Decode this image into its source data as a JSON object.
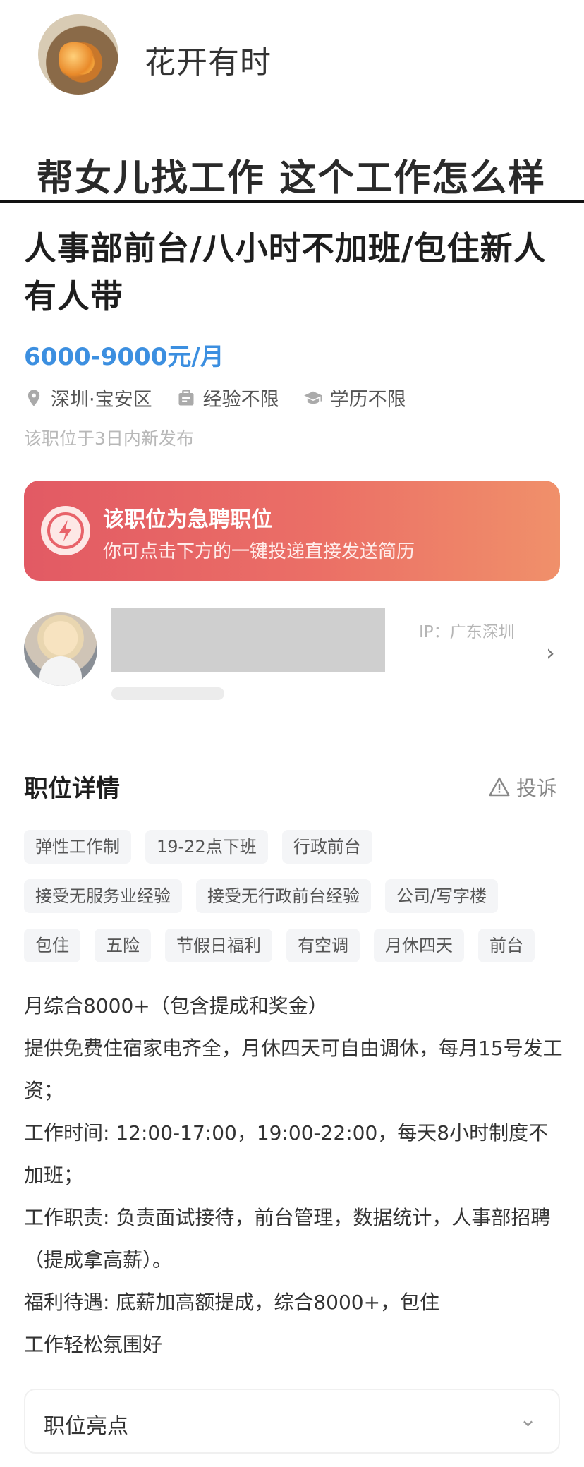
{
  "poster": {
    "name": "花开有时",
    "caption": "帮女儿找工作 这个工作怎么样"
  },
  "job": {
    "title": "人事部前台/八小时不加班/包住新人有人带",
    "salary": "6000-9000元/月",
    "location": "深圳·宝安区",
    "experience": "经验不限",
    "education": "学历不限",
    "posted": "该职位于3日内新发布"
  },
  "urgent": {
    "title": "该职位为急聘职位",
    "subtitle": "你可点击下方的一键投递直接发送简历"
  },
  "recruiter": {
    "ip": "IP：广东深圳"
  },
  "details": {
    "section_title": "职位详情",
    "report_label": "投诉",
    "tags": [
      [
        "弹性工作制",
        "19-22点下班",
        "行政前台"
      ],
      [
        "接受无服务业经验",
        "接受无行政前台经验",
        "公司/写字楼"
      ],
      [
        "包住",
        "五险",
        "节假日福利",
        "有空调",
        "月休四天",
        "前台"
      ]
    ],
    "description": [
      "月综合8000+（包含提成和奖金）",
      "提供免费住宿家电齐全，月休四天可自由调休，每月15号发工资；",
      "工作时间: 12:00-17:00，19:00-22:00，每天8小时制度不加班；",
      "工作职责: 负责面试接待，前台管理，数据统计，人事部招聘（提成拿高薪）。",
      "福利待遇: 底薪加高额提成，综合8000+，包住",
      "工作轻松氛围好"
    ]
  },
  "highlights": {
    "label": "职位亮点"
  },
  "colors": {
    "salary": "#3c8fe0",
    "urgent_start": "#e25a64",
    "urgent_end": "#f0906a"
  }
}
